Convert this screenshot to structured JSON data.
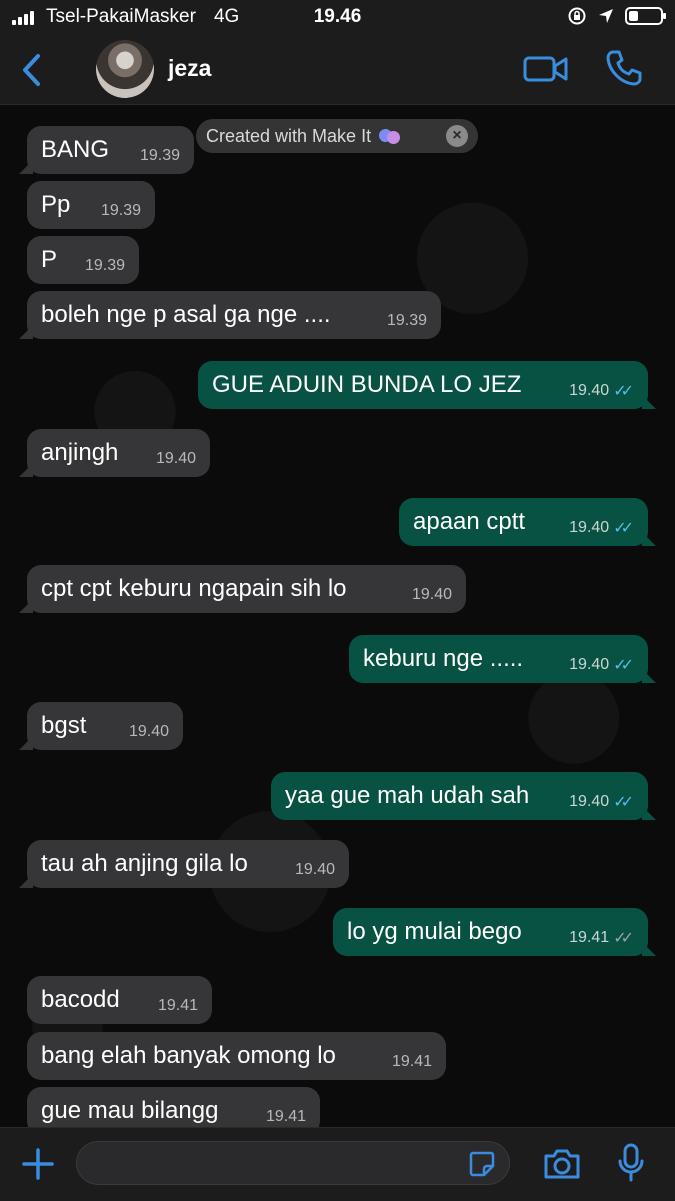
{
  "status_bar": {
    "carrier": "Tsel-PakaiMasker",
    "network": "4G",
    "time": "19.46"
  },
  "header": {
    "contact_name": "jeza"
  },
  "watermark": {
    "text": "Created with Make It"
  },
  "messages": [
    {
      "dir": "in",
      "text": "BANG",
      "time": "19.39"
    },
    {
      "dir": "in",
      "text": "Pp",
      "time": "19.39"
    },
    {
      "dir": "in",
      "text": "P",
      "time": "19.39"
    },
    {
      "dir": "in",
      "text": "boleh nge p asal ga nge ....",
      "time": "19.39"
    },
    {
      "dir": "out",
      "text": "GUE ADUIN BUNDA LO JEZ",
      "time": "19.40",
      "read": true
    },
    {
      "dir": "in",
      "text": "anjingh",
      "time": "19.40"
    },
    {
      "dir": "out",
      "text": "apaan cptt",
      "time": "19.40",
      "read": true
    },
    {
      "dir": "in",
      "text": "cpt cpt keburu ngapain sih lo",
      "time": "19.40"
    },
    {
      "dir": "out",
      "text": "keburu nge .....",
      "time": "19.40",
      "read": true
    },
    {
      "dir": "in",
      "text": "bgst",
      "time": "19.40"
    },
    {
      "dir": "out",
      "text": "yaa gue mah udah sah",
      "time": "19.40",
      "read": true
    },
    {
      "dir": "in",
      "text": "tau ah anjing gila lo",
      "time": "19.40"
    },
    {
      "dir": "out",
      "text": "lo yg mulai bego",
      "time": "19.41",
      "read": false
    },
    {
      "dir": "in",
      "text": "bacodd",
      "time": "19.41"
    },
    {
      "dir": "in",
      "text": "bang elah banyak omong lo",
      "time": "19.41"
    },
    {
      "dir": "in",
      "text": "gue mau bilangg",
      "time": "19.41"
    }
  ],
  "input": {
    "placeholder": ""
  },
  "colors": {
    "incoming_bubble": "#363638",
    "outgoing_bubble": "#075243",
    "accent": "#3a8dde",
    "read_ticks": "#53bdeb"
  }
}
